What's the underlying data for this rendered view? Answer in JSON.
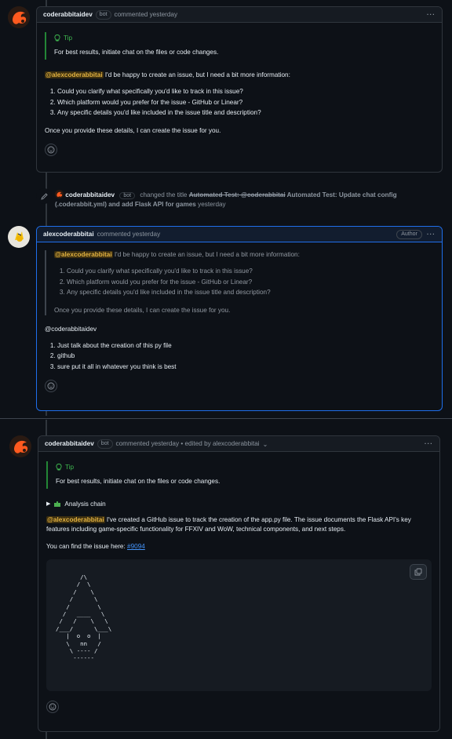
{
  "comment1": {
    "username": "coderabbitaidev",
    "bot_badge": "bot",
    "meta": "commented yesterday",
    "tip_title": "Tip",
    "tip_text": "For best results, initiate chat on the files or code changes.",
    "mention": "@alexcoderabbitai",
    "intro": " I'd be happy to create an issue, but I need a bit more information:",
    "questions": [
      "Could you clarify what specifically you'd like to track in this issue?",
      "Which platform would you prefer for the issue - GitHub or Linear?",
      "Any specific details you'd like included in the issue title and description?"
    ],
    "closing": "Once you provide these details, I can create the issue for you."
  },
  "event": {
    "username": "coderabbitaidev",
    "bot_badge": "bot",
    "action": " changed the title ",
    "old_title": "Automated Test: @coderabbitai",
    "new_title": " Automated Test: Update chat config (.coderabbit.yml) and add Flask API for games",
    "time": " yesterday"
  },
  "comment2": {
    "username": "alexcoderabbitai",
    "meta": "commented yesterday",
    "author_badge": "Author",
    "quote_mention": "@alexcoderabbitai",
    "quote_intro": " I'd be happy to create an issue, but I need a bit more information:",
    "quote_questions": [
      "Could you clarify what specifically you'd like to track in this issue?",
      "Which platform would you prefer for the issue - GitHub or Linear?",
      "Any specific details you'd like included in the issue title and description?"
    ],
    "quote_closing": "Once you provide these details, I can create the issue for you.",
    "reply_mention": "@coderabbitaidev",
    "answers": [
      "Just talk about the creation of this py file",
      "github",
      "sure put it all in whatever you think is best"
    ]
  },
  "comment3": {
    "username": "coderabbitaidev",
    "bot_badge": "bot",
    "meta": "commented yesterday • edited by alexcoderabbitai",
    "tip_title": "Tip",
    "tip_text": "For best results, initiate chat on the files or code changes.",
    "analysis_chain": "Analysis chain",
    "mention": "@alexcoderabbitai",
    "body": " I've created a GitHub issue to track the creation of the app.py file. The issue documents the Flask API's key features including game-specific functionality for FFXIV and WoW, technical components, and next steps.",
    "find_text": "You can find the issue here: ",
    "issue_link": "#9094",
    "ascii_art": "       /\\\n      /  \\\n     /    \\\n    /      \\\n   /        \\\n  /   ____   \\\n /   /    \\   \\\n/___/      \\___\\\n   |  o  o  |\n   \\   nn   /\n    \\ ---- /\n     ------"
  },
  "colors": {
    "background": "#0d1117",
    "border": "#30363d",
    "author_border": "#1f6feb",
    "tip_green": "#3fb950",
    "mention_yellow": "#e3b341",
    "link_blue": "#4493f8"
  }
}
